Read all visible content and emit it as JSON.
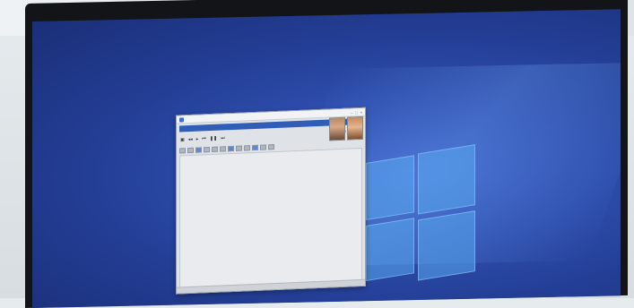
{
  "window": {
    "title": "",
    "address": "",
    "toolbar": {
      "icons": [
        "save-icon",
        "back-icon",
        "forward-icon",
        "skip-back-icon",
        "pause-icon",
        "skip-forward-icon",
        "trash-icon",
        "attach-icon",
        "flag-icon"
      ]
    },
    "body_lines": [
      "",
      "",
      "",
      "",
      ""
    ],
    "status": "",
    "status_right": ""
  },
  "colors": {
    "desktop": "#2f4fb0",
    "address_bar": "#2f5db8"
  }
}
